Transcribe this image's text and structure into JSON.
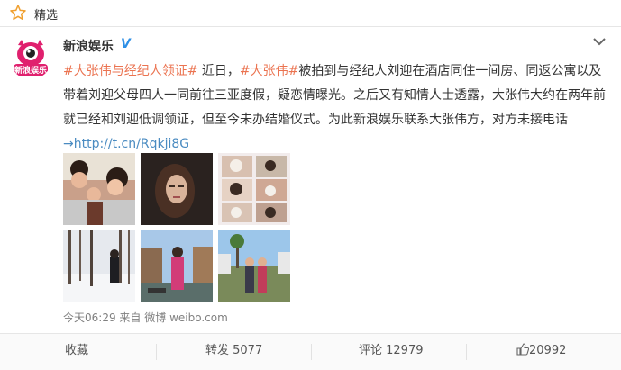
{
  "header": {
    "title": "精选"
  },
  "post": {
    "author": "新浪娱乐",
    "verified_badge": "V",
    "avatar_text": "新浪娱乐",
    "segments": [
      {
        "type": "tag",
        "text": "#大张伟与经纪人领证#"
      },
      {
        "type": "text",
        "text": " 近日，"
      },
      {
        "type": "tag",
        "text": "#大张伟#"
      },
      {
        "type": "text",
        "text": "被拍到与经纪人刘迎在酒店同住一间房、同返公寓以及带着刘迎父母四人一同前往三亚度假，疑恋情曝光。之后又有知情人士透露，大张伟大约在两年前就已经和刘迎低调领证，但至今未办结婚仪式。为此新浪娱乐联系大张伟方，对方未接电话"
      },
      {
        "type": "link",
        "text": "→http://t.cn/Rqkji8G"
      }
    ],
    "time": "今天06:29",
    "source_prefix": "来自",
    "source": "微博 weibo.com"
  },
  "actions": {
    "favorite": "收藏",
    "repost": "转发 5077",
    "comment": "评论 12979",
    "like": "20992"
  },
  "colors": {
    "tag": "#eb7350",
    "link": "#4a8bc1",
    "verified": "#2d8fe6"
  }
}
